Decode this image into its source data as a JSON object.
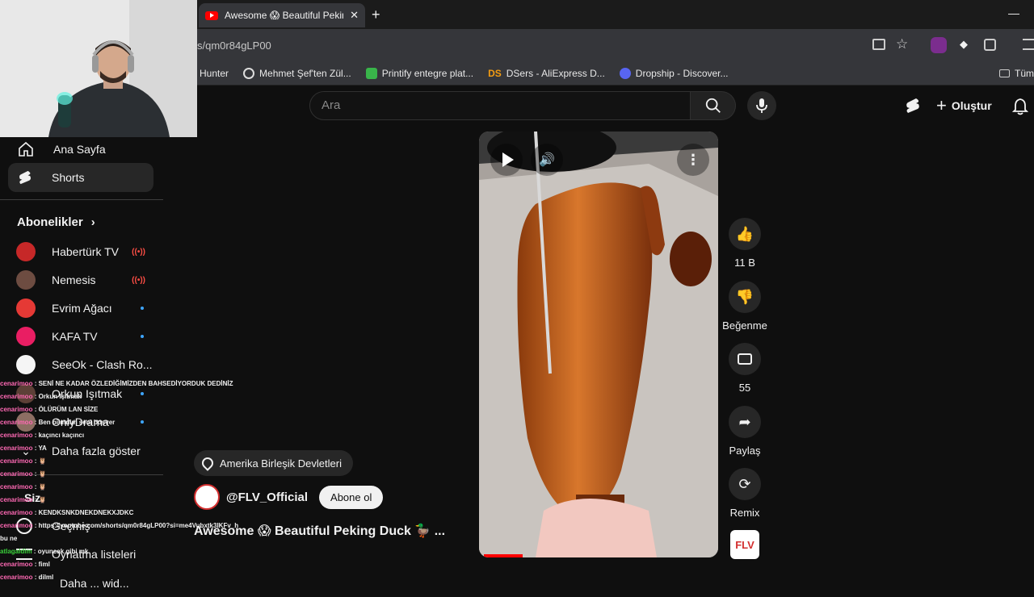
{
  "browser": {
    "tab_title": "Awesome 😱 Beautiful Peking",
    "url": "s/qm0r84gLP00",
    "bookmarks": [
      "Hunter",
      "Mehmet Şef'ten Zül...",
      "Printify entegre plat...",
      "DSers - AliExpress D...",
      "Dropship - Discover..."
    ],
    "bookmarks_right": "Tüm"
  },
  "header": {
    "search_placeholder": "Ara",
    "create_label": "Oluştur"
  },
  "sidebar": {
    "home": "Ana Sayfa",
    "shorts": "Shorts",
    "subs_heading": "Abonelikler",
    "subscriptions": [
      {
        "name": "Habertürk TV",
        "status": "live",
        "color": "#c62828"
      },
      {
        "name": "Nemesis",
        "status": "live",
        "color": "#6d4c41"
      },
      {
        "name": "Evrim Ağacı",
        "status": "new",
        "color": "#e53935"
      },
      {
        "name": "KAFA TV",
        "status": "new",
        "color": "#e91e63"
      },
      {
        "name": "SeeOk - Clash Ro...",
        "status": "new",
        "color": "#f5f5f5"
      },
      {
        "name": "Orkun Işıtmak",
        "status": "new",
        "color": "#5d4037"
      },
      {
        "name": "OnlyDrama",
        "status": "new",
        "color": "#8d6e63"
      }
    ],
    "show_more": "Daha fazla göster",
    "you_label": "Siz",
    "history": "Geçmiş",
    "playlists": "Oynatma listeleri",
    "bottom": "Daha ... wid..."
  },
  "short": {
    "location": "Amerika Birleşik Devletleri",
    "channel": "@FLV_Official",
    "subscribe": "Abone ol",
    "title": "Awesome 😱 Beautiful Peking Duck 🦆 ...",
    "likes": "11 B",
    "dislike_label": "Beğenme",
    "comments": "55",
    "share_label": "Paylaş",
    "remix_label": "Remix",
    "channel_badge": "FLV"
  },
  "chat": [
    {
      "user": "cenarimoo",
      "msg": "SENİ NE KADAR ÖZLEDİĞİMİZDEN BAHSEDİYORDUK DEDİNİZ"
    },
    {
      "user": "cenarimoo",
      "msg": "Orkun Işıtmak"
    },
    {
      "user": "cenarimoo",
      "msg": "ÖLÜRÜM LAN SİZE"
    },
    {
      "user": "cenarimoo",
      "msg": "Ben bilmdim seni boşver"
    },
    {
      "user": "cenarimoo",
      "msg": "kaçıncı kaçıncı"
    },
    {
      "user": "cenarimoo",
      "msg": "YA"
    },
    {
      "user": "cenarimoo",
      "msg": "🦉"
    },
    {
      "user": "cenarimoo",
      "msg": "🦉"
    },
    {
      "user": "cenarimoo",
      "msg": "🦉"
    },
    {
      "user": "cenarimoo",
      "msg": "🦉"
    },
    {
      "user": "cenarimoo",
      "msg": "KENDKSNKDNEKDNEKXJDKC"
    },
    {
      "user": "cenarimoo",
      "msg": "https://youtube.com/shorts/qm0r84gLP00?si=me4Vubxtk3IKFv_h"
    },
    {
      "user": "",
      "msg": "bu ne"
    },
    {
      "user": "atlagaldim",
      "msg": "oyuncak gibi mk"
    },
    {
      "user": "cenarimoo",
      "msg": "fiml"
    },
    {
      "user": "cenarimoo",
      "msg": "dilml"
    }
  ],
  "colors": {
    "accent_red": "#ff0000",
    "bg": "#0f0f0f",
    "duck": "#c9631e"
  }
}
